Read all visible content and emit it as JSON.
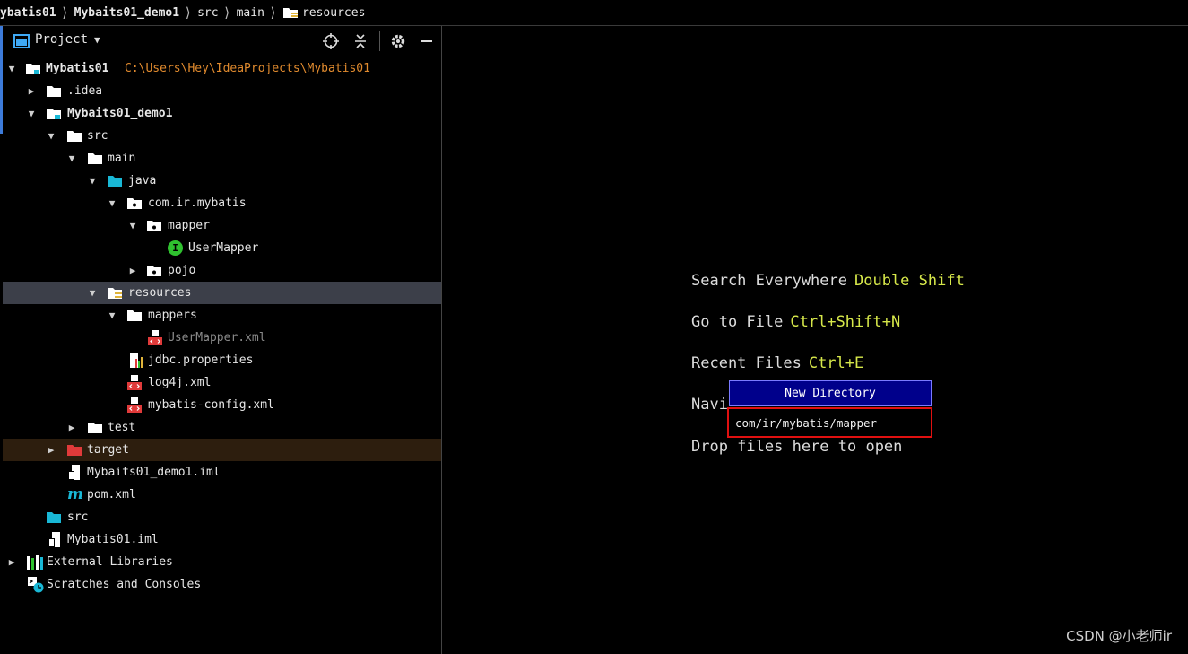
{
  "breadcrumb": {
    "items": [
      "ybatis01",
      "Mybaits01_demo1",
      "src",
      "main",
      "resources"
    ]
  },
  "panel": {
    "title": "Project",
    "icons": [
      "locate-icon",
      "collapse-all-icon",
      "gear-icon",
      "minimize-icon"
    ]
  },
  "tree": [
    {
      "label": "Mybatis01",
      "path": "C:\\Users\\Hey\\IdeaProjects\\Mybatis01",
      "icon": "module-folder-icon"
    },
    {
      "label": ".idea",
      "icon": "folder-icon"
    },
    {
      "label": "Mybaits01_demo1",
      "icon": "module-folder-icon"
    },
    {
      "label": "src",
      "icon": "folder-icon"
    },
    {
      "label": "main",
      "icon": "folder-icon"
    },
    {
      "label": "java",
      "icon": "source-folder-icon"
    },
    {
      "label": "com.ir.mybatis",
      "icon": "package-icon"
    },
    {
      "label": "mapper",
      "icon": "package-icon"
    },
    {
      "label": "UserMapper",
      "icon": "interface-icon",
      "icon_glyph": "I"
    },
    {
      "label": "pojo",
      "icon": "package-icon"
    },
    {
      "label": "resources",
      "icon": "resources-folder-icon"
    },
    {
      "label": "mappers",
      "icon": "folder-icon"
    },
    {
      "label": "UserMapper.xml",
      "icon": "xml-file-icon"
    },
    {
      "label": "jdbc.properties",
      "icon": "properties-file-icon"
    },
    {
      "label": "log4j.xml",
      "icon": "xml-file-icon"
    },
    {
      "label": "mybatis-config.xml",
      "icon": "xml-file-icon"
    },
    {
      "label": "test",
      "icon": "folder-icon"
    },
    {
      "label": "target",
      "icon": "excluded-folder-icon"
    },
    {
      "label": "Mybaits01_demo1.iml",
      "icon": "iml-file-icon"
    },
    {
      "label": "pom.xml",
      "icon": "maven-icon",
      "icon_glyph": "m"
    },
    {
      "label": "src",
      "icon": "source-folder-icon"
    },
    {
      "label": "Mybatis01.iml",
      "icon": "iml-file-icon"
    },
    {
      "label": "External Libraries",
      "icon": "libraries-icon"
    },
    {
      "label": "Scratches and Consoles",
      "icon": "scratches-icon"
    }
  ],
  "editor_hints": [
    {
      "text": "Search Everywhere",
      "key": "Double Shift"
    },
    {
      "text": "Go to File",
      "key": "Ctrl+Shift+N"
    },
    {
      "text": "Recent Files",
      "key": "Ctrl+E"
    },
    {
      "text": "Navi",
      "key": ""
    },
    {
      "text": "Drop files here to open",
      "key": ""
    }
  ],
  "new_directory": {
    "title": "New Directory",
    "value": "com/ir/mybatis/mapper"
  },
  "watermark": "CSDN @小老师ir",
  "colors": {
    "selection": "#3c3f49",
    "excluded": "#2d1e0e",
    "popup_title": "#00008b",
    "popup_border": "#e01010",
    "key_hint": "#d7e84a",
    "path": "#e08a2e"
  }
}
